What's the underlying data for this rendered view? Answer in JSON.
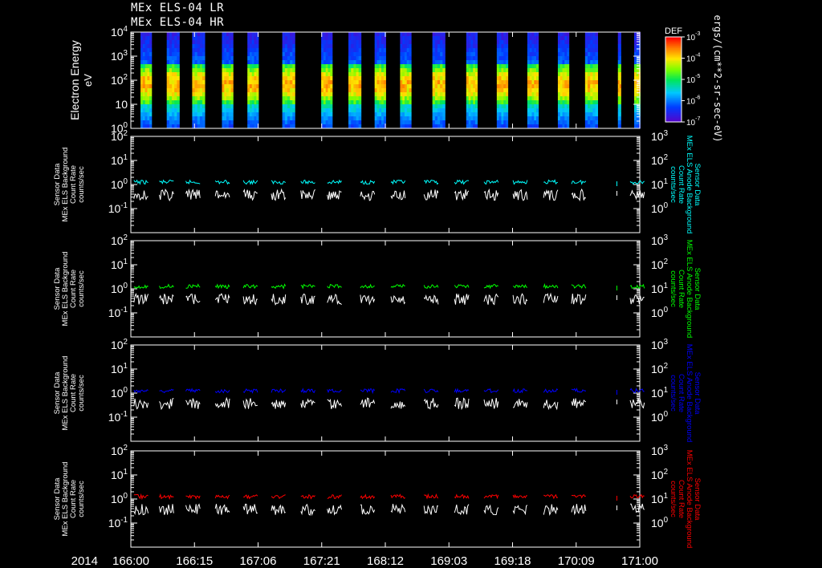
{
  "titles": [
    "MEx ELS-04 LR",
    "MEx ELS-04 HR"
  ],
  "colors": {
    "background": "#000000",
    "frame": "#ffffff",
    "anode_lines": [
      "#00ffff",
      "#00ff00",
      "#0000ff",
      "#ff0000"
    ],
    "white_line": "#ffffff"
  },
  "colorbar": {
    "label": "DEF",
    "unit_label": "ergs/(cm**2-sr-sec-eV)",
    "ticks": [
      {
        "mantissa": "10",
        "exp": "-3"
      },
      {
        "mantissa": "10",
        "exp": "-4"
      },
      {
        "mantissa": "10",
        "exp": "-5"
      },
      {
        "mantissa": "10",
        "exp": "-6"
      },
      {
        "mantissa": "10",
        "exp": "-7"
      }
    ]
  },
  "time_axis": {
    "year_label": "2014",
    "ticks": [
      "166:00",
      "166:15",
      "167:06",
      "167:21",
      "168:12",
      "169:03",
      "169:18",
      "170:09",
      "171:00"
    ]
  },
  "chart_data": [
    {
      "type": "heatmap",
      "ylabel": "Electron Energy",
      "yunit": "eV",
      "yscale": "log",
      "ylim": [
        1,
        10000
      ],
      "yticks": [
        {
          "mantissa": "10",
          "exp": "4"
        },
        {
          "mantissa": "10",
          "exp": "3"
        },
        {
          "mantissa": "10",
          "exp": "2"
        },
        {
          "mantissa": "10",
          "exp": ""
        },
        {
          "mantissa": "10",
          "exp": "0"
        }
      ],
      "colorbar_range": [
        1e-07,
        0.001
      ],
      "bursts_x": [
        0.03,
        0.083,
        0.133,
        0.19,
        0.24,
        0.31,
        0.385,
        0.44,
        0.49,
        0.54,
        0.605,
        0.67,
        0.73,
        0.79,
        0.85,
        0.905,
        0.96,
        0.995
      ],
      "burst_widths": [
        0.022,
        0.025,
        0.025,
        0.022,
        0.022,
        0.025,
        0.022,
        0.025,
        0.022,
        0.022,
        0.025,
        0.022,
        0.022,
        0.022,
        0.022,
        0.025,
        0.006,
        0.012
      ]
    },
    {
      "type": "line",
      "ylabel_lines": [
        "Sensor Data",
        "MEx ELS Background",
        "Count Rate",
        "counts/sec"
      ],
      "right_label_lines": [
        "Sensor Data",
        "MEx ELS Anode Background",
        "Count Rate",
        "counts/sec"
      ],
      "yscale": "log",
      "ylim": [
        0.01,
        100
      ],
      "ylim_right": [
        0.1,
        1000
      ],
      "left_ticks": [
        {
          "mantissa": "10",
          "exp": "2"
        },
        {
          "mantissa": "10",
          "exp": "1"
        },
        {
          "mantissa": "10",
          "exp": "0"
        },
        {
          "mantissa": "10",
          "exp": "-1"
        }
      ],
      "right_ticks": [
        {
          "mantissa": "10",
          "exp": "3"
        },
        {
          "mantissa": "10",
          "exp": "2"
        },
        {
          "mantissa": "10",
          "exp": "1"
        },
        {
          "mantissa": "10",
          "exp": "0"
        }
      ],
      "series": [
        {
          "color": "#00ffff",
          "level": 0.85
        },
        {
          "color": "#ffffff",
          "level": 0.5
        }
      ]
    },
    {
      "type": "line",
      "ylabel_lines": [
        "Sensor Data",
        "MEx ELS Background",
        "Count Rate",
        "counts/sec"
      ],
      "right_label_lines": [
        "Sensor Data",
        "MEx ELS Anode Background",
        "Count Rate",
        "counts/sec"
      ],
      "yscale": "log",
      "ylim": [
        0.01,
        100
      ],
      "ylim_right": [
        0.1,
        1000
      ],
      "left_ticks": [
        {
          "mantissa": "10",
          "exp": "2"
        },
        {
          "mantissa": "10",
          "exp": "1"
        },
        {
          "mantissa": "10",
          "exp": "0"
        },
        {
          "mantissa": "10",
          "exp": "-1"
        }
      ],
      "right_ticks": [
        {
          "mantissa": "10",
          "exp": "3"
        },
        {
          "mantissa": "10",
          "exp": "2"
        },
        {
          "mantissa": "10",
          "exp": "1"
        },
        {
          "mantissa": "10",
          "exp": "0"
        }
      ],
      "series": [
        {
          "color": "#00ff00",
          "level": 0.9
        },
        {
          "color": "#ffffff",
          "level": 0.5
        }
      ]
    },
    {
      "type": "line",
      "ylabel_lines": [
        "Sensor Data",
        "MEx ELS Background",
        "Count Rate",
        "counts/sec"
      ],
      "right_label_lines": [
        "Sensor Data",
        "MEx ELS Anode Background",
        "Count Rate",
        "counts/sec"
      ],
      "yscale": "log",
      "ylim": [
        0.01,
        100
      ],
      "ylim_right": [
        0.1,
        1000
      ],
      "left_ticks": [
        {
          "mantissa": "10",
          "exp": "2"
        },
        {
          "mantissa": "10",
          "exp": "1"
        },
        {
          "mantissa": "10",
          "exp": "0"
        },
        {
          "mantissa": "10",
          "exp": "-1"
        }
      ],
      "right_ticks": [
        {
          "mantissa": "10",
          "exp": "3"
        },
        {
          "mantissa": "10",
          "exp": "2"
        },
        {
          "mantissa": "10",
          "exp": "1"
        },
        {
          "mantissa": "10",
          "exp": "0"
        }
      ],
      "series": [
        {
          "color": "#0000ff",
          "level": 0.85
        },
        {
          "color": "#ffffff",
          "level": 0.5
        }
      ]
    },
    {
      "type": "line",
      "ylabel_lines": [
        "Sensor Data",
        "MEx ELS Background",
        "Count Rate",
        "counts/sec"
      ],
      "right_label_lines": [
        "Sensor Data",
        "MEx ELS Anode Background",
        "Count Rate",
        "counts/sec"
      ],
      "yscale": "log",
      "ylim": [
        0.01,
        100
      ],
      "ylim_right": [
        0.1,
        1000
      ],
      "left_ticks": [
        {
          "mantissa": "10",
          "exp": "2"
        },
        {
          "mantissa": "10",
          "exp": "1"
        },
        {
          "mantissa": "10",
          "exp": "0"
        },
        {
          "mantissa": "10",
          "exp": "-1"
        }
      ],
      "right_ticks": [
        {
          "mantissa": "10",
          "exp": "3"
        },
        {
          "mantissa": "10",
          "exp": "2"
        },
        {
          "mantissa": "10",
          "exp": "1"
        },
        {
          "mantissa": "10",
          "exp": "0"
        }
      ],
      "series": [
        {
          "color": "#ff0000",
          "level": 0.9
        },
        {
          "color": "#ffffff",
          "level": 0.45
        }
      ]
    }
  ]
}
